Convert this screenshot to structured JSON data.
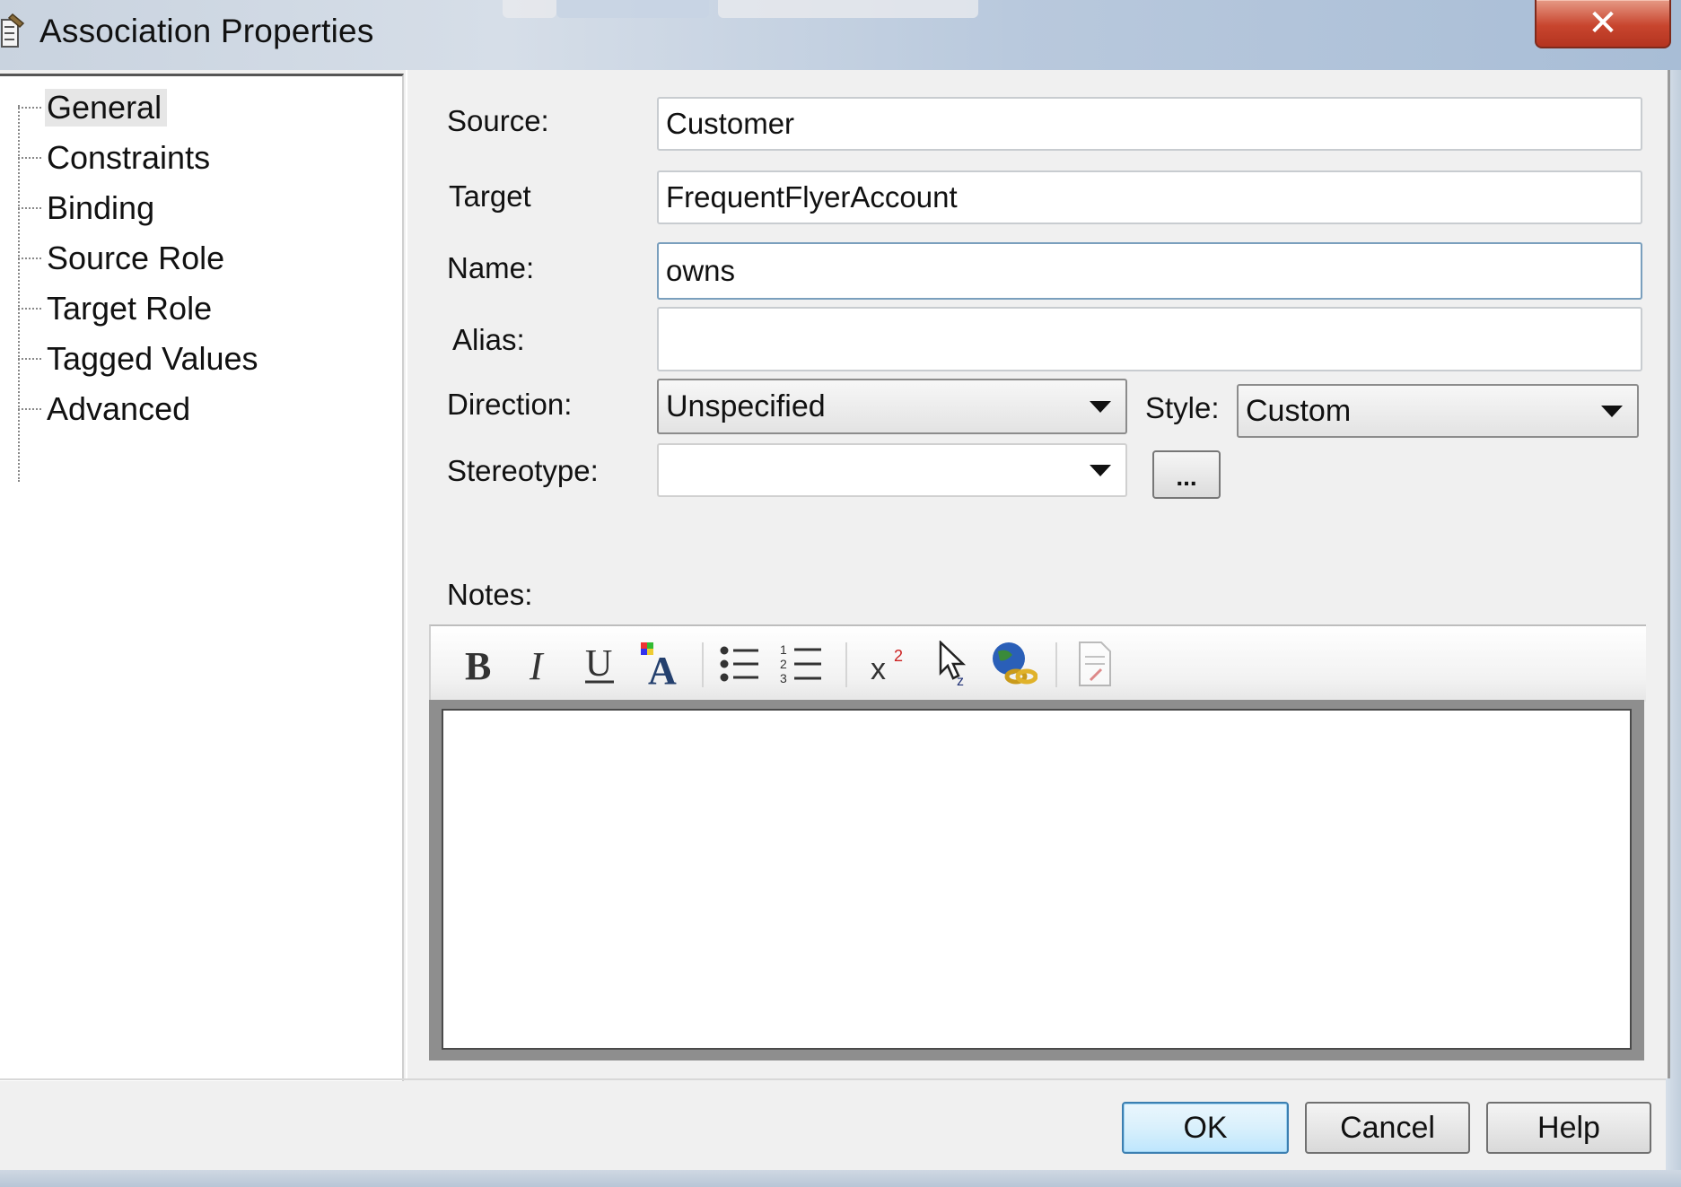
{
  "window": {
    "title": "Association Properties",
    "close_label": "✕"
  },
  "tree": {
    "items": [
      {
        "label": "General",
        "selected": true
      },
      {
        "label": "Constraints"
      },
      {
        "label": "Binding"
      },
      {
        "label": "Source Role"
      },
      {
        "label": "Target Role"
      },
      {
        "label": "Tagged Values"
      },
      {
        "label": "Advanced"
      }
    ]
  },
  "form": {
    "source": {
      "label": "Source:",
      "value": "Customer"
    },
    "target": {
      "label": "Target",
      "value": "FrequentFlyerAccount"
    },
    "name": {
      "label": "Name:",
      "value": "owns"
    },
    "alias": {
      "label": "Alias:",
      "value": ""
    },
    "direction": {
      "label": "Direction:",
      "value": "Unspecified"
    },
    "style": {
      "label": "Style:",
      "value": "Custom"
    },
    "stereotype": {
      "label": "Stereotype:",
      "value": "",
      "ellipsis_label": "..."
    }
  },
  "notes": {
    "label": "Notes:",
    "toolbar": [
      {
        "name": "bold-icon",
        "glyph": "B"
      },
      {
        "name": "italic-icon",
        "glyph": "I"
      },
      {
        "name": "underline-icon",
        "glyph": "U"
      },
      {
        "name": "font-color-icon",
        "glyph": "A"
      },
      {
        "name": "bullet-list-icon"
      },
      {
        "name": "numbered-list-icon"
      },
      {
        "name": "superscript-icon",
        "glyph": "x²"
      },
      {
        "name": "insert-link-cursor-icon"
      },
      {
        "name": "hyperlink-globe-icon"
      },
      {
        "name": "document-icon"
      }
    ],
    "value": ""
  },
  "buttons": {
    "ok": "OK",
    "cancel": "Cancel",
    "help": "Help"
  },
  "colors": {
    "close_button": "#c8452e",
    "default_button_border": "#3c7fb1",
    "notes_frame": "#8e8e8e"
  }
}
